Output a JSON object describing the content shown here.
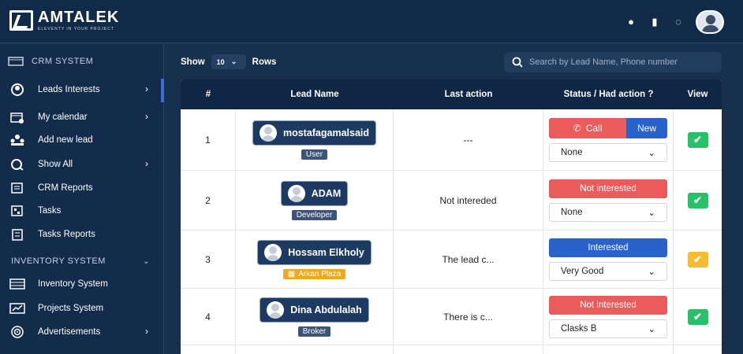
{
  "brand": {
    "name": "AMTALEK",
    "tagline": "ELEVENTY IN YOUR PROJECT"
  },
  "header": {
    "icons": [
      "chat-icon",
      "bell-icon",
      "avatar"
    ]
  },
  "sidebar": {
    "crm_section": "CRM SYSTEM",
    "items": [
      {
        "label": "Leads Interests",
        "icon": "person-icon",
        "chevron": "›"
      },
      {
        "label": "My calendar",
        "icon": "calendar-icon",
        "chevron": "›"
      },
      {
        "label": "Add new lead",
        "icon": "add-group-icon"
      },
      {
        "label": "Show All",
        "icon": "search-icon",
        "chevron": "›"
      },
      {
        "label": "CRM Reports",
        "icon": "report-icon"
      },
      {
        "label": "Tasks",
        "icon": "tasks-icon"
      },
      {
        "label": "Tasks Reports",
        "icon": "clipboard-icon"
      }
    ],
    "inventory_section": "INVENTORY SYSTEM",
    "inventory_items": [
      {
        "label": "Inventory System",
        "icon": "list-icon"
      },
      {
        "label": "Projects System",
        "icon": "chart-icon"
      },
      {
        "label": "Advertisements",
        "icon": "target-icon",
        "chevron": "›"
      }
    ]
  },
  "main": {
    "show_label": "Show",
    "show_value": "10",
    "rows_label": "Rows",
    "search_placeholder": "Search by Lead Name, Phone number",
    "columns": [
      "#",
      "Lead Name",
      "Last action",
      "Status / Had action ?",
      "View"
    ],
    "rows": [
      {
        "num": "1",
        "name": "mostafagamalsaid",
        "role": "User",
        "last_action": "---",
        "call_label": "Call",
        "new_label": "New",
        "select": "None",
        "check": "✔"
      },
      {
        "num": "2",
        "name": "ADAM",
        "role": "Developer",
        "last_action": "Not intereded",
        "status": "Not interested",
        "select": "None",
        "check": "✔"
      },
      {
        "num": "3",
        "name": "Hossam Elkholy",
        "role": "Arkan Plaza",
        "last_action": "The lead c...",
        "status": "Interested",
        "select": "Very Good",
        "check": "✔"
      },
      {
        "num": "4",
        "name": "Dina Abdulalah",
        "role": "Broker",
        "last_action": "There is c...",
        "status": "Not interested",
        "select": "Clasks B",
        "check": "✔"
      }
    ]
  },
  "colors": {
    "navy": "#132c4b",
    "red": "#ea5b5b",
    "blue": "#2a62cc",
    "green": "#29c06a",
    "yellow": "#f5bd2d"
  }
}
